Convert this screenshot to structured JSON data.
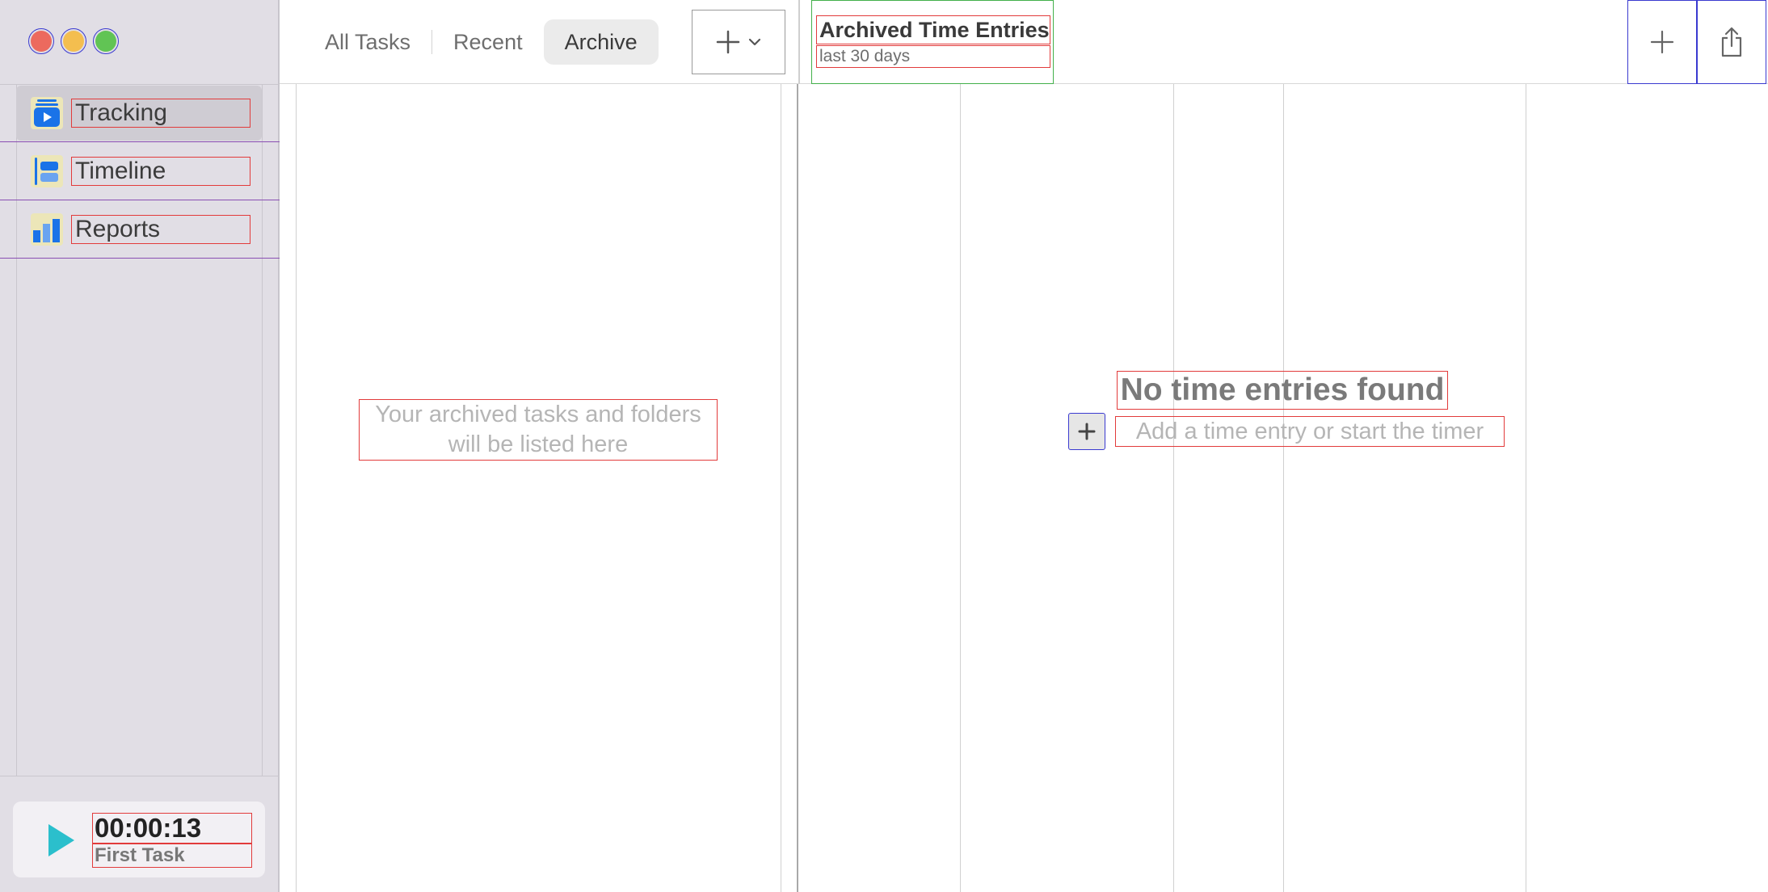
{
  "window": {
    "controls": [
      "close",
      "minimize",
      "zoom"
    ]
  },
  "sidebar": {
    "items": [
      {
        "label": "Tracking",
        "icon": "tracking-icon",
        "active": true
      },
      {
        "label": "Timeline",
        "icon": "timeline-icon",
        "active": false
      },
      {
        "label": "Reports",
        "icon": "reports-icon",
        "active": false
      }
    ],
    "timer": {
      "time": "00:00:13",
      "task": "First Task"
    }
  },
  "toolbar": {
    "tabs": [
      {
        "label": "All Tasks",
        "active": false
      },
      {
        "label": "Recent",
        "active": false
      },
      {
        "label": "Archive",
        "active": true
      }
    ],
    "entries_title": "Archived Time Entries",
    "entries_subtitle": "last 30 days"
  },
  "archive": {
    "empty_message": "Your archived tasks and folders will be listed here"
  },
  "entries": {
    "empty_title": "No time entries found",
    "empty_subtitle": "Add a time entry or start the timer"
  },
  "colors": {
    "accent": "#1a73e8",
    "play": "#2bbfcc",
    "sidebar_bg": "#e1dee5"
  }
}
